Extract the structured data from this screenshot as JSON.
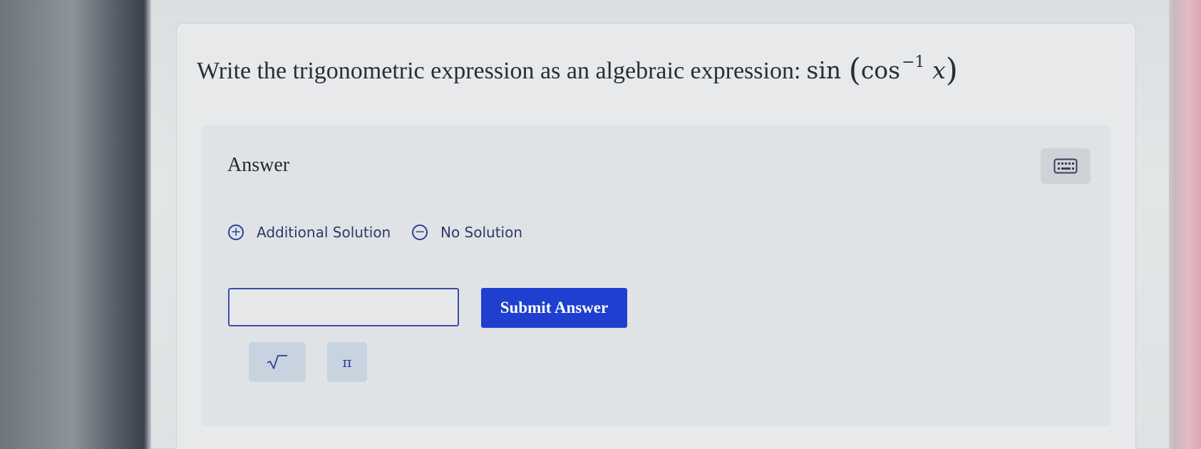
{
  "question": {
    "prompt": "Write the trigonometric expression as an algebraic expression:",
    "expr_func": "sin",
    "expr_open": "(",
    "expr_inner": "cos",
    "expr_exp": "−1",
    "expr_var": "x",
    "expr_close": ")"
  },
  "answer": {
    "label": "Answer",
    "keyboard_icon": "keyboard-icon",
    "options": {
      "additional_solution": "Additional Solution",
      "no_solution": "No Solution"
    },
    "input_value": "",
    "submit_label": "Submit Answer",
    "tools": {
      "sqrt": "√",
      "pi": "π"
    }
  },
  "colors": {
    "accent": "#1f3fd0",
    "link": "#2c3e9c"
  }
}
